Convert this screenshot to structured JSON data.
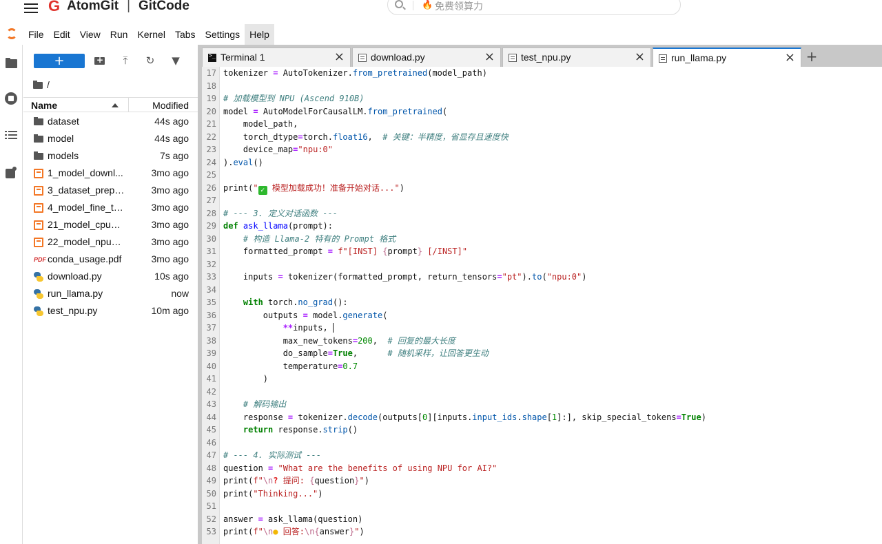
{
  "browser": {
    "brand_left": "AtomGit",
    "brand_right": "GitCode",
    "search_placeholder": "免费领算力"
  },
  "menubar": {
    "items": [
      "File",
      "Edit",
      "View",
      "Run",
      "Kernel",
      "Tabs",
      "Settings",
      "Help"
    ],
    "active": "Help"
  },
  "filebrowser": {
    "new_label": "+",
    "breadcrumb": "/",
    "col_name": "Name",
    "col_modified": "Modified",
    "files": [
      {
        "name": "dataset",
        "modified": "44s ago",
        "type": "dir"
      },
      {
        "name": "model",
        "modified": "44s ago",
        "type": "dir"
      },
      {
        "name": "models",
        "modified": "7s ago",
        "type": "dir"
      },
      {
        "name": "1_model_downl...",
        "modified": "3mo ago",
        "type": "notebook"
      },
      {
        "name": "3_dataset_prepa...",
        "modified": "3mo ago",
        "type": "notebook"
      },
      {
        "name": "4_model_fine_tu...",
        "modified": "3mo ago",
        "type": "notebook"
      },
      {
        "name": "21_model_cpu_i...",
        "modified": "3mo ago",
        "type": "notebook"
      },
      {
        "name": "22_model_npu_i...",
        "modified": "3mo ago",
        "type": "notebook"
      },
      {
        "name": "conda_usage.pdf",
        "modified": "3mo ago",
        "type": "pdf"
      },
      {
        "name": "download.py",
        "modified": "10s ago",
        "type": "python"
      },
      {
        "name": "run_llama.py",
        "modified": "now",
        "type": "python"
      },
      {
        "name": "test_npu.py",
        "modified": "10m ago",
        "type": "python"
      }
    ]
  },
  "tabs": [
    {
      "label": "Terminal 1",
      "icon": "terminal-icon",
      "active": false
    },
    {
      "label": "download.py",
      "icon": "python-file-icon",
      "active": false
    },
    {
      "label": "test_npu.py",
      "icon": "python-file-icon",
      "active": false
    },
    {
      "label": "run_llama.py",
      "icon": "python-file-icon",
      "active": true
    }
  ],
  "add_tab_label": "+",
  "editor": {
    "first_line": 17,
    "lines": [
      "tokenizer = AutoTokenizer.from_pretrained(model_path)",
      "",
      "# 加载模型到 NPU (Ascend 910B)",
      "model = AutoModelForCausalLM.from_pretrained(",
      "    model_path,",
      "    torch_dtype=torch.float16,  # 关键：半精度，省显存且速度快",
      "    device_map=\"npu:0\"",
      ").eval()",
      "",
      "print(\"✅ 模型加载成功！准备开始对话...\")",
      "",
      "# --- 3. 定义对话函数 ---",
      "def ask_llama(prompt):",
      "    # 构造 Llama-2 特有的 Prompt 格式",
      "    formatted_prompt = f\"[INST] {prompt} [/INST]\"",
      "",
      "    inputs = tokenizer(formatted_prompt, return_tensors=\"pt\").to(\"npu:0\")",
      "",
      "    with torch.no_grad():",
      "        outputs = model.generate(",
      "            **inputs, ",
      "            max_new_tokens=200,  # 回复的最大长度",
      "            do_sample=True,      # 随机采样，让回答更生动",
      "            temperature=0.7",
      "        )",
      "",
      "    # 解码输出",
      "    response = tokenizer.decode(outputs[0][inputs.input_ids.shape[1]:], skip_special_tokens=True)",
      "    return response.strip()",
      "",
      "# --- 4. 实际测试 ---",
      "question = \"What are the benefits of using NPU for AI?\"",
      "print(f\"\\n❓ 提问: {question}\")",
      "print(\"Thinking...\")",
      "",
      "answer = ask_llama(question)",
      "print(f\"\\n💡 回答:\\n{answer}\")"
    ]
  },
  "colors": {
    "accent": "#1976d2",
    "jupyter_orange": "#f37726",
    "brand_red": "#e0332d"
  }
}
